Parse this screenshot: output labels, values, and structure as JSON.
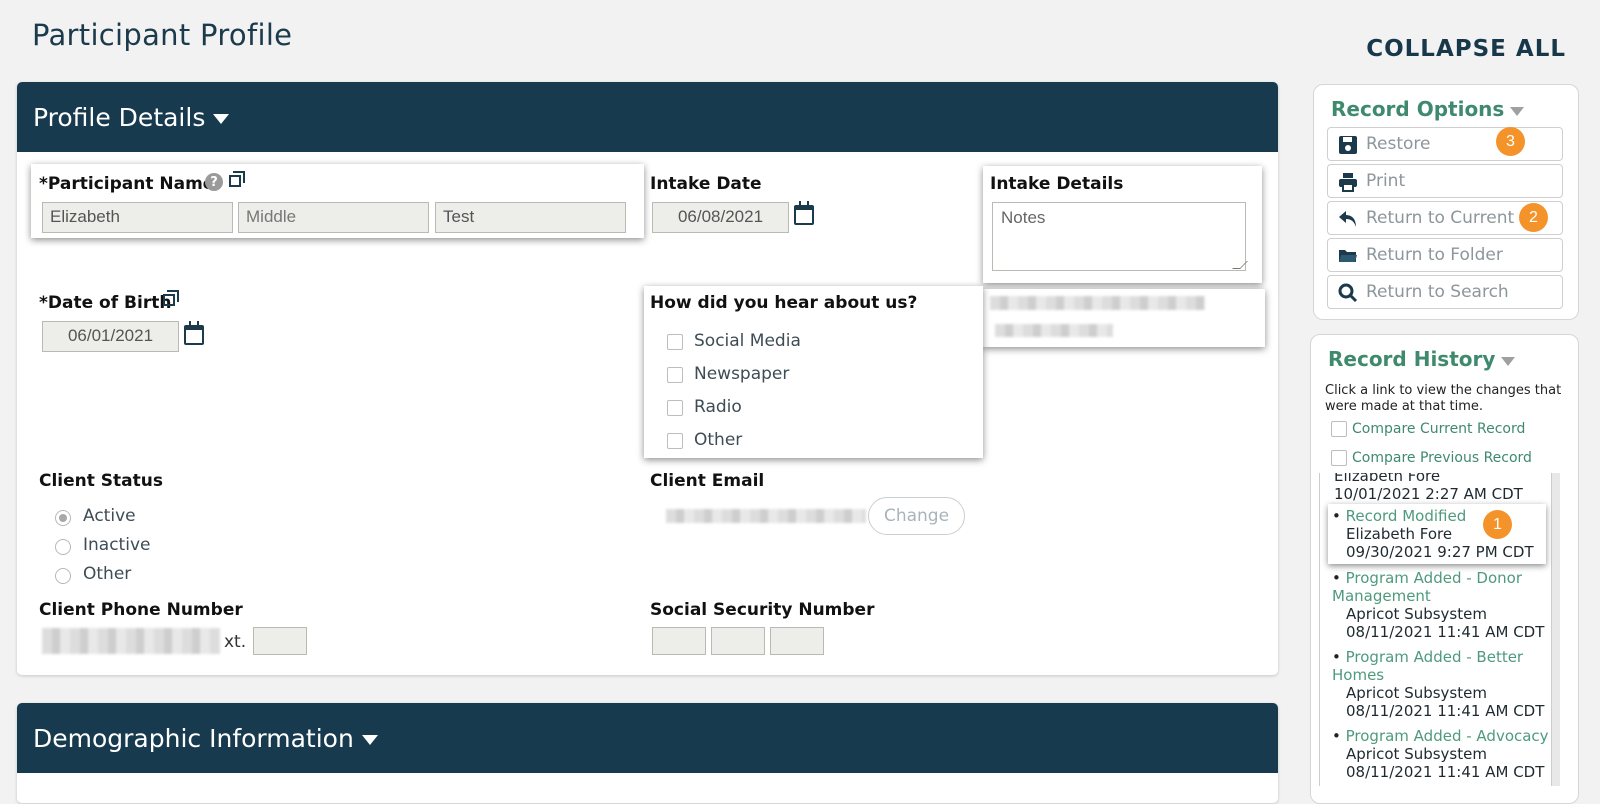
{
  "page_title": "Participant Profile",
  "collapse_all": "COLLAPSE ALL",
  "profile": {
    "header": "Profile Details",
    "participant_name": {
      "label": "*Participant Name",
      "first": "Elizabeth",
      "middle_placeholder": "Middle",
      "last": "Test"
    },
    "intake_date": {
      "label": "Intake Date",
      "value": "06/08/2021"
    },
    "intake_details": {
      "label": "Intake Details",
      "placeholder": "Notes"
    },
    "dob": {
      "label": "*Date of Birth",
      "value": "06/01/2021"
    },
    "hear_about": {
      "label": "How did you hear about us?",
      "options": [
        "Social Media",
        "Newspaper",
        "Radio",
        "Other"
      ]
    },
    "client_status": {
      "label": "Client Status",
      "options": [
        "Active",
        "Inactive",
        "Other"
      ],
      "selected": "Active"
    },
    "client_email": {
      "label": "Client Email",
      "change": "Change"
    },
    "client_phone": {
      "label": "Client Phone Number",
      "ext_label": "xt."
    },
    "ssn": {
      "label": "Social Security Number"
    }
  },
  "demographic": {
    "header": "Demographic Information"
  },
  "record_options": {
    "title": "Record Options",
    "buttons": [
      {
        "label": "Restore",
        "icon": "save-icon",
        "badge": "3"
      },
      {
        "label": "Print",
        "icon": "print-icon",
        "badge": ""
      },
      {
        "label": "Return to Current",
        "icon": "return-icon",
        "badge": "2"
      },
      {
        "label": "Return to Folder",
        "icon": "folder-icon",
        "badge": ""
      },
      {
        "label": "Return to Search",
        "icon": "search-icon",
        "badge": ""
      }
    ]
  },
  "record_history": {
    "title": "Record History",
    "hint": "Click a link to view the changes that were made at that time.",
    "compare_current": "Compare Current Record",
    "compare_previous": "Compare Previous Record",
    "items": [
      {
        "link": "",
        "user": "Elizabeth Fore",
        "time": "10/01/2021 2:27 AM CDT"
      },
      {
        "link": "Record Modified",
        "user": "Elizabeth Fore",
        "time": "09/30/2021 9:27 PM CDT",
        "badge": "1"
      },
      {
        "link": "Program Added - Donor Management",
        "user": "Apricot Subsystem",
        "time": "08/11/2021 11:41 AM CDT"
      },
      {
        "link": "Program Added - Better Homes",
        "user": "Apricot Subsystem",
        "time": "08/11/2021 11:41 AM CDT"
      },
      {
        "link": "Program Added - Advocacy",
        "user": "Apricot Subsystem",
        "time": "08/11/2021 11:41 AM CDT"
      }
    ]
  },
  "colors": {
    "header": "#173a4e",
    "accent": "#3f8a6f",
    "badge": "#f5932b"
  }
}
